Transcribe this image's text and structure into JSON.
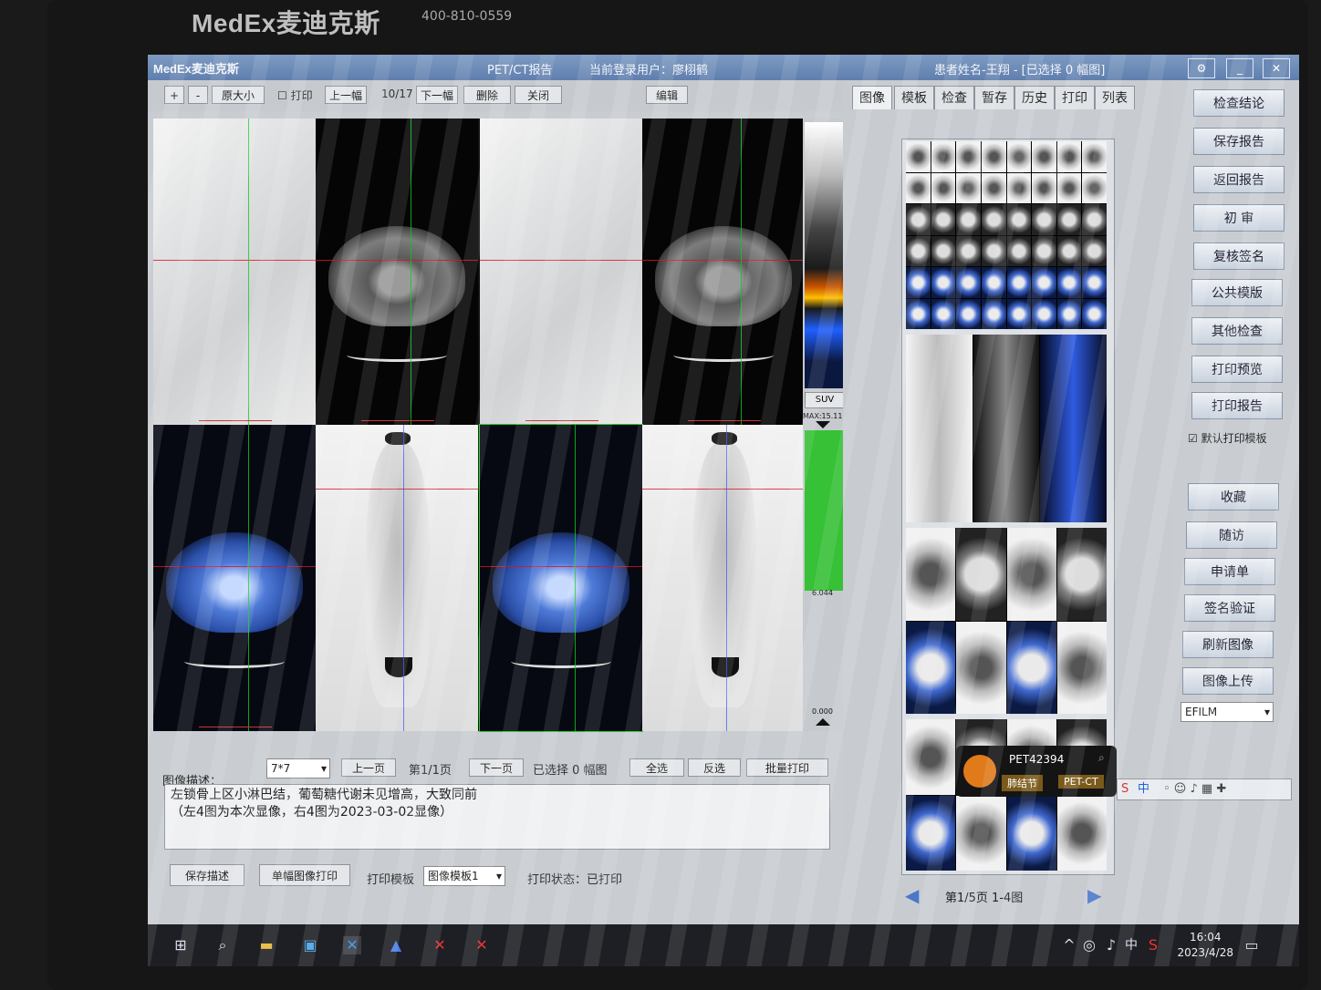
{
  "monitor": {
    "brand": "MedEx麦迪克斯",
    "phone": "400-810-0559"
  },
  "titlebar": {
    "logo": "MedEx麦迪克斯",
    "module": "PET/CT报告",
    "login_label": "当前登录用户：廖栩鹤",
    "patient": "患者姓名-王翔 - [已选择 0 幅图]"
  },
  "toolbar": {
    "zoom_in": "+",
    "zoom_out": "-",
    "original_size": "原大小",
    "print_check": "打印",
    "prev_image": "上一幅",
    "counter": "10/17",
    "next_image": "下一幅",
    "delete": "删除",
    "close": "关闭",
    "edit": "编辑"
  },
  "colorbar": {
    "suv_button": "SUV",
    "max": "MAX:15.11",
    "min_top": "6.044",
    "min_bottom": "0.000"
  },
  "tabs": [
    "图像",
    "模板",
    "检查",
    "暂存",
    "历史",
    "打印",
    "列表"
  ],
  "thumbs_pager": {
    "text": "第1/5页 1-4图"
  },
  "description": {
    "layout_value": "7*7",
    "prev_page": "上一页",
    "page_info": "第1/1页",
    "next_page": "下一页",
    "selected": "已选择 0 幅图",
    "select_all": "全选",
    "invert": "反选",
    "batch_print": "批量打印",
    "label": "图像描述：",
    "text_line1": "左锁骨上区小淋巴结，葡萄糖代谢未见增高，大致同前",
    "text_line2": "（左4图为本次显像，右4图为2023-03-02显像）"
  },
  "bottom": {
    "save_desc": "保存描述",
    "single_print": "单幅图像打印",
    "template_label": "打印模板",
    "template_value": "图像模板1",
    "status": "打印状态：已打印"
  },
  "right_buttons": [
    "检查结论",
    "保存报告",
    "返回报告",
    "初 审",
    "复核签名",
    "公共模版",
    "其他检查",
    "打印预览",
    "打印报告"
  ],
  "default_template": "默认打印模板",
  "right_buttons2": [
    "收藏",
    "随访",
    "申请单",
    "签名验证",
    "刷新图像",
    "图像上传"
  ],
  "efilm": "EFILM",
  "popup": {
    "id": "PET42394",
    "tag1": "肺结节",
    "tag2": "PET-CT"
  },
  "ime": {
    "lang": "中"
  },
  "taskbar": {
    "lang": "中",
    "time": "16:04",
    "date": "2023/4/28"
  }
}
